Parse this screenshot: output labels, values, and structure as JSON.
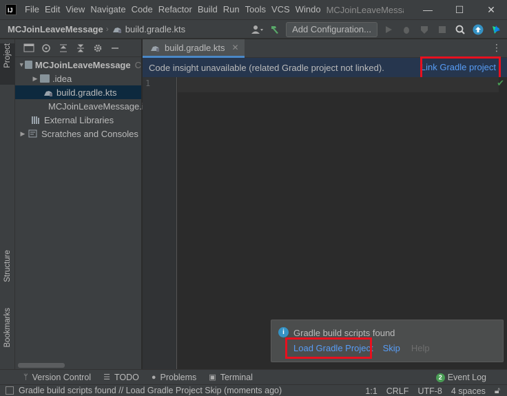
{
  "titlebar": {
    "app_logo": "IJ",
    "menu": [
      "File",
      "Edit",
      "View",
      "Navigate",
      "Code",
      "Refactor",
      "Build",
      "Run",
      "Tools",
      "VCS",
      "Windo"
    ],
    "window_title": "MCJoinLeaveMessag",
    "controls": [
      "—",
      "☐",
      "✕"
    ]
  },
  "navbar": {
    "project": "MCJoinLeaveMessage",
    "file": "build.gradle.kts",
    "add_configuration": "Add Configuration..."
  },
  "left_stripe": {
    "project": "Project",
    "structure": "Structure",
    "bookmarks": "Bookmarks"
  },
  "project_tree": {
    "root": "MCJoinLeaveMessage",
    "root_suffix": "C",
    "idea": ".idea",
    "build_file": "build.gradle.kts",
    "iml_file": "MCJoinLeaveMessage.i",
    "external_libraries": "External Libraries",
    "scratches": "Scratches and Consoles"
  },
  "editor": {
    "tab_label": "build.gradle.kts",
    "banner_text": "Code insight unavailable (related Gradle project not linked).",
    "banner_link": "Link Gradle project",
    "line_number": "1"
  },
  "notification": {
    "title": "Gradle build scripts found",
    "load": "Load Gradle Project",
    "skip": "Skip",
    "help": "Help"
  },
  "bottom_tools": {
    "version_control": "Version Control",
    "todo": "TODO",
    "problems": "Problems",
    "terminal": "Terminal",
    "event_log": "Event Log",
    "event_count": "2"
  },
  "statusbar": {
    "message": "Gradle build scripts found // Load Gradle Project   Skip (moments ago)",
    "position": "1:1",
    "line_sep": "CRLF",
    "encoding": "UTF-8",
    "indent": "4 spaces"
  },
  "colors": {
    "highlight_box": "#e8101e",
    "link": "#589df6",
    "selection": "#0d293e",
    "banner": "#26364e"
  }
}
